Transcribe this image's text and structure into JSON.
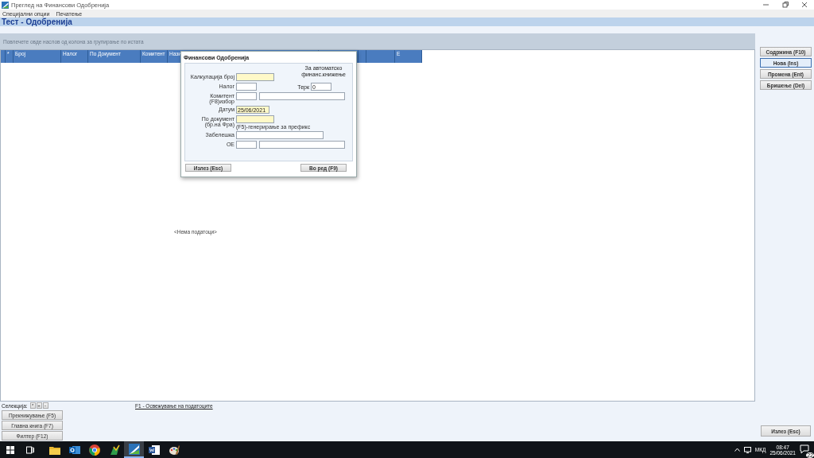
{
  "window": {
    "title": "Преглед на Финансови Одобренија"
  },
  "menu": [
    "Специјални опции",
    "Печатење"
  ],
  "header": "Тест - Одобренија",
  "group_hint": "Повлечете овде наслов од колона за групирање по истата",
  "table": {
    "columns": [
      {},
      {
        "label": "*"
      },
      {
        "label": "Број"
      },
      {
        "label": "Налог"
      },
      {
        "label": "По Документ"
      },
      {
        "label": "Комитент"
      },
      {
        "label": "Нази"
      },
      {},
      {},
      {},
      {
        "label": "Е"
      }
    ],
    "empty": "<Нема податоци>"
  },
  "side_buttons": [
    {
      "label": "Содржина (F10)",
      "selected": false
    },
    {
      "label": "Нова (Ins)",
      "selected": true
    },
    {
      "label": "Промена (Ent)",
      "selected": false
    },
    {
      "label": "Бришење (Del)",
      "selected": false
    }
  ],
  "selection": {
    "label": "Селекција:",
    "buttons": [
      "*",
      "+",
      "-"
    ]
  },
  "bottom_buttons": [
    "Прекнижување (F5)",
    "Главна книга (F7)",
    "Филтер (F12)"
  ],
  "refresh_link": "F1 - Освежување на податоците",
  "exit_button": "Излез (Esc)",
  "dialog": {
    "title": "Финансови Одобренија",
    "note": "За автоматско финанс.книжење",
    "rows": [
      {
        "label": "Калкулација број",
        "fields": [
          {
            "highlighted": true
          }
        ]
      },
      {
        "label": "Налог",
        "fields": [
          {
            "highlighted": false
          }
        ],
        "extra": {
          "label": "Терк",
          "value": "0"
        }
      },
      {
        "label": "Комитент (F8)избор",
        "fields": [
          {
            "highlighted": false
          },
          {
            "highlighted": false
          }
        ]
      },
      {
        "label": "Датум",
        "fields": [
          {
            "value": "25/06/2021",
            "highlighted": true
          }
        ]
      },
      {
        "label": "По документ (бр.на Фра)",
        "fields": [
          {
            "highlighted": true
          }
        ],
        "hint": "(F5)-генерирање за префикс"
      },
      {
        "label": "Забелешка",
        "fields": [
          {
            "highlighted": false
          }
        ]
      },
      {
        "label": "ОЕ",
        "fields": [
          {
            "highlighted": false
          },
          {
            "highlighted": false
          }
        ]
      }
    ],
    "buttons": [
      "Излез (Esc)",
      "Во ред (F9)"
    ]
  },
  "taskbar": {
    "apps": [
      {
        "kind": "explorer",
        "selected": false
      },
      {
        "kind": "outlook",
        "selected": false
      },
      {
        "kind": "chrome",
        "selected": false
      },
      {
        "kind": "tool",
        "selected": false
      },
      {
        "kind": "finance",
        "selected": true
      },
      {
        "kind": "word",
        "selected": false
      },
      {
        "kind": "paint",
        "selected": false
      }
    ],
    "language": "МКД",
    "time": "08:47",
    "date": "25/06/2021",
    "notifications": "22"
  }
}
